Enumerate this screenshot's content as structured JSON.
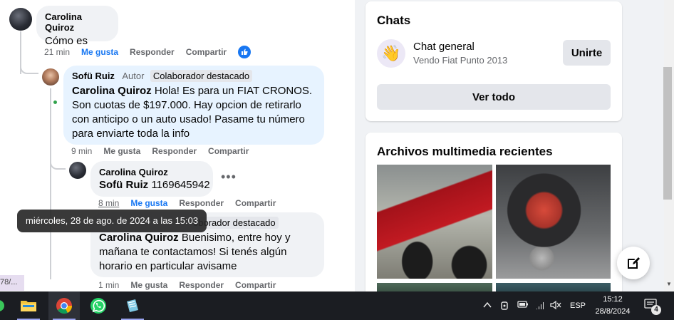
{
  "comments": {
    "c1": {
      "author": "Carolina Quiroz",
      "text": "Cómo es",
      "time": "21 min",
      "actions": [
        "Me gusta",
        "Responder",
        "Compartir"
      ],
      "reaction_icon": "thumbs-up-icon"
    },
    "c2": {
      "author": "Sofü Ruiz",
      "author_tag": "Autor",
      "badge": "Colaborador destacado",
      "mention": "Carolina Quiroz",
      "text": "Hola! Es para un FIAT CRONOS. Son cuotas de $197.000. Hay opcion de retirarlo con anticipo o un auto usado! Pasame tu número para enviarte toda la info",
      "time": "9 min",
      "actions": [
        "Me gusta",
        "Responder",
        "Compartir"
      ]
    },
    "c3": {
      "author": "Carolina Quiroz",
      "mention": "Sofü Ruiz",
      "text": "1169645942",
      "time": "8 min",
      "actions": [
        "Me gusta",
        "Responder",
        "Compartir"
      ]
    },
    "c4": {
      "badge_partial": "oborador destacado",
      "mention": "Carolina Quiroz",
      "text": "Buenisimo, entre hoy y mañana te contactamos! Si tenés algún horario en particular avisame",
      "time": "1 min",
      "actions": [
        "Me gusta",
        "Responder",
        "Compartir"
      ]
    }
  },
  "tooltip": "miércoles, 28 de ago. de 2024 a las 15:03",
  "left_stub": "78/...",
  "chats_card": {
    "title": "Chats",
    "chat_name": "Chat general",
    "chat_sub": "Vendo Fiat Punto 2013",
    "join_label": "Unirte",
    "see_all_label": "Ver todo",
    "avatar_emoji": "👋"
  },
  "media_card": {
    "title": "Archivos multimedia recientes"
  },
  "fab_icon": "compose-icon",
  "taskbar": {
    "apps": [
      "file-explorer-icon",
      "chrome-icon",
      "whatsapp-icon",
      "notepad-icon"
    ],
    "tray": {
      "language": "ESP",
      "time": "15:12",
      "date": "28/8/2024",
      "notifications": "4"
    }
  },
  "colors": {
    "accent": "#1877f2",
    "bubble_gray": "#f0f2f5",
    "bubble_blue": "#e7f3ff",
    "taskbar": "#1b1d22"
  }
}
